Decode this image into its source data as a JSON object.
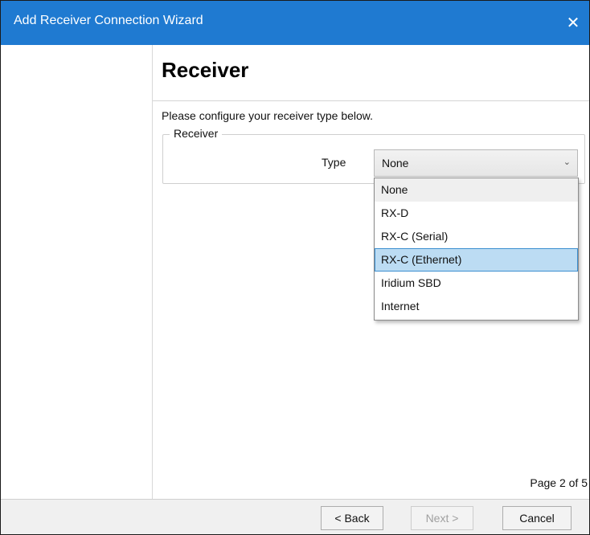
{
  "window": {
    "title": "Add Receiver Connection Wizard",
    "close_glyph": "✕",
    "title_bar_color": "#1f7ad1"
  },
  "header": {
    "heading": "Receiver"
  },
  "content": {
    "instructions": "Please configure your receiver type below.",
    "group_label": "Receiver",
    "type_label": "Type",
    "type_select": {
      "selected": "None",
      "chevron_icon": "chevron-down-icon",
      "options": [
        "None",
        "RX-D",
        "RX-C (Serial)",
        "RX-C (Ethernet)",
        "Iridium SBD",
        "Internet"
      ],
      "highlighted_option": "RX-C (Ethernet)"
    },
    "page_info": "Page 2 of 5"
  },
  "footer": {
    "back_label": "< Back",
    "next_label": "Next >",
    "cancel_label": "Cancel"
  }
}
